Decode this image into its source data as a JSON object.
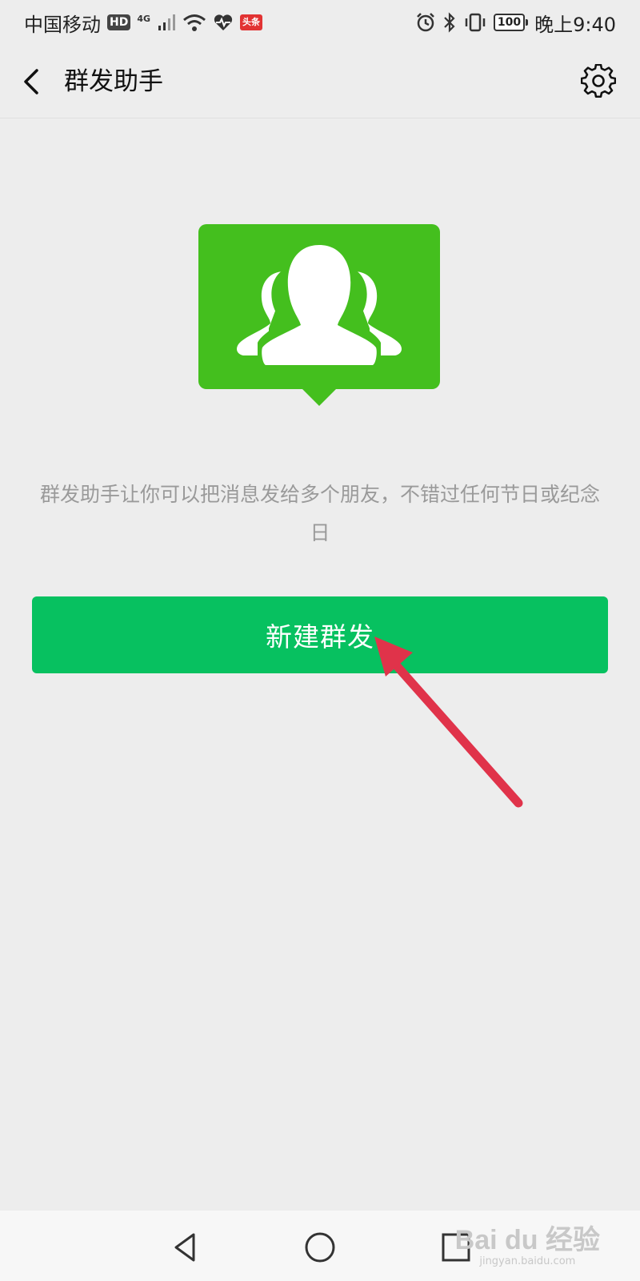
{
  "status_bar": {
    "carrier": "中国移动",
    "hd_badge": "HD",
    "network": "4G",
    "news_badge": "头条",
    "battery": "100",
    "time": "晚上9:40"
  },
  "nav": {
    "title": "群发助手",
    "back_icon": "chevron-left-icon",
    "settings_icon": "gear-icon"
  },
  "main": {
    "illustration_icon": "group-users-icon",
    "illustration_color": "#44bf1e",
    "description": "群发助手让你可以把消息发给多个朋友，不错过任何节日或纪念日",
    "new_button_label": "新建群发",
    "button_color": "#07c160"
  },
  "annotation": {
    "arrow_color": "#e0334a"
  },
  "watermark": {
    "logo": "Bai du 经验",
    "sub": "jingyan.baidu.com"
  }
}
